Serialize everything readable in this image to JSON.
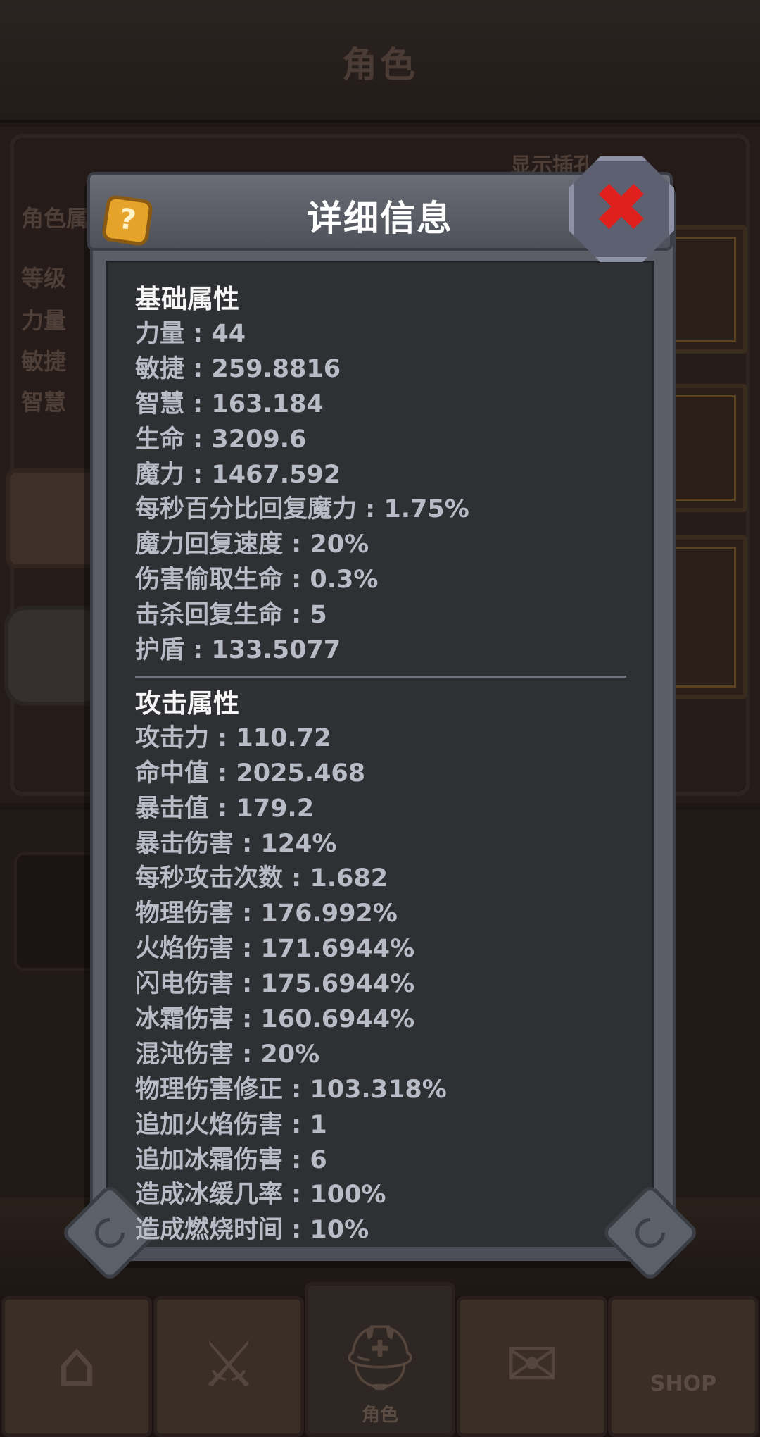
{
  "background": {
    "title": "角色",
    "show_socket_label": "显示插孔",
    "panel_label": "角色属",
    "left_labels": [
      "等级",
      "力量",
      "敏捷",
      "智慧"
    ]
  },
  "dialog": {
    "title": "详细信息",
    "help_icon": "question-icon",
    "close_icon": "close-x-icon",
    "help_glyph": "?",
    "close_glyph": "✖"
  },
  "basic": {
    "title": "基础属性",
    "items": [
      "力量 : 44",
      "敏捷 : 259.8816",
      "智慧 : 163.184",
      "生命 : 3209.6",
      "魔力 : 1467.592",
      "每秒百分比回复魔力 : 1.75%",
      "魔力回复速度 : 20%",
      "伤害偷取生命 : 0.3%",
      "击杀回复生命 : 5",
      "护盾 : 133.5077"
    ]
  },
  "attack": {
    "title": "攻击属性",
    "items": [
      "攻击力 : 110.72",
      "命中值 : 2025.468",
      "暴击值 : 179.2",
      "暴击伤害 : 124%",
      "每秒攻击次数 : 1.682",
      "物理伤害 : 176.992%",
      "火焰伤害 : 171.6944%",
      "闪电伤害 : 175.6944%",
      "冰霜伤害 : 160.6944%",
      "混沌伤害 : 20%",
      "物理伤害修正 : 103.318%",
      "追加火焰伤害 : 1",
      "追加冰霜伤害 : 6",
      "造成冰缓几率 : 100%",
      "造成燃烧时间 : 10%"
    ]
  },
  "nav": {
    "items": [
      {
        "icon": "home-icon",
        "glyph": "⌂",
        "label": ""
      },
      {
        "icon": "sword-shield-icon",
        "glyph": "⚔",
        "label": ""
      },
      {
        "icon": "helmet-icon",
        "glyph": "⛑",
        "label": "角色"
      },
      {
        "icon": "scroll-icon",
        "glyph": "✉",
        "label": ""
      },
      {
        "icon": "shop-icon",
        "glyph": "",
        "label": "",
        "text": "SHOP"
      }
    ]
  }
}
